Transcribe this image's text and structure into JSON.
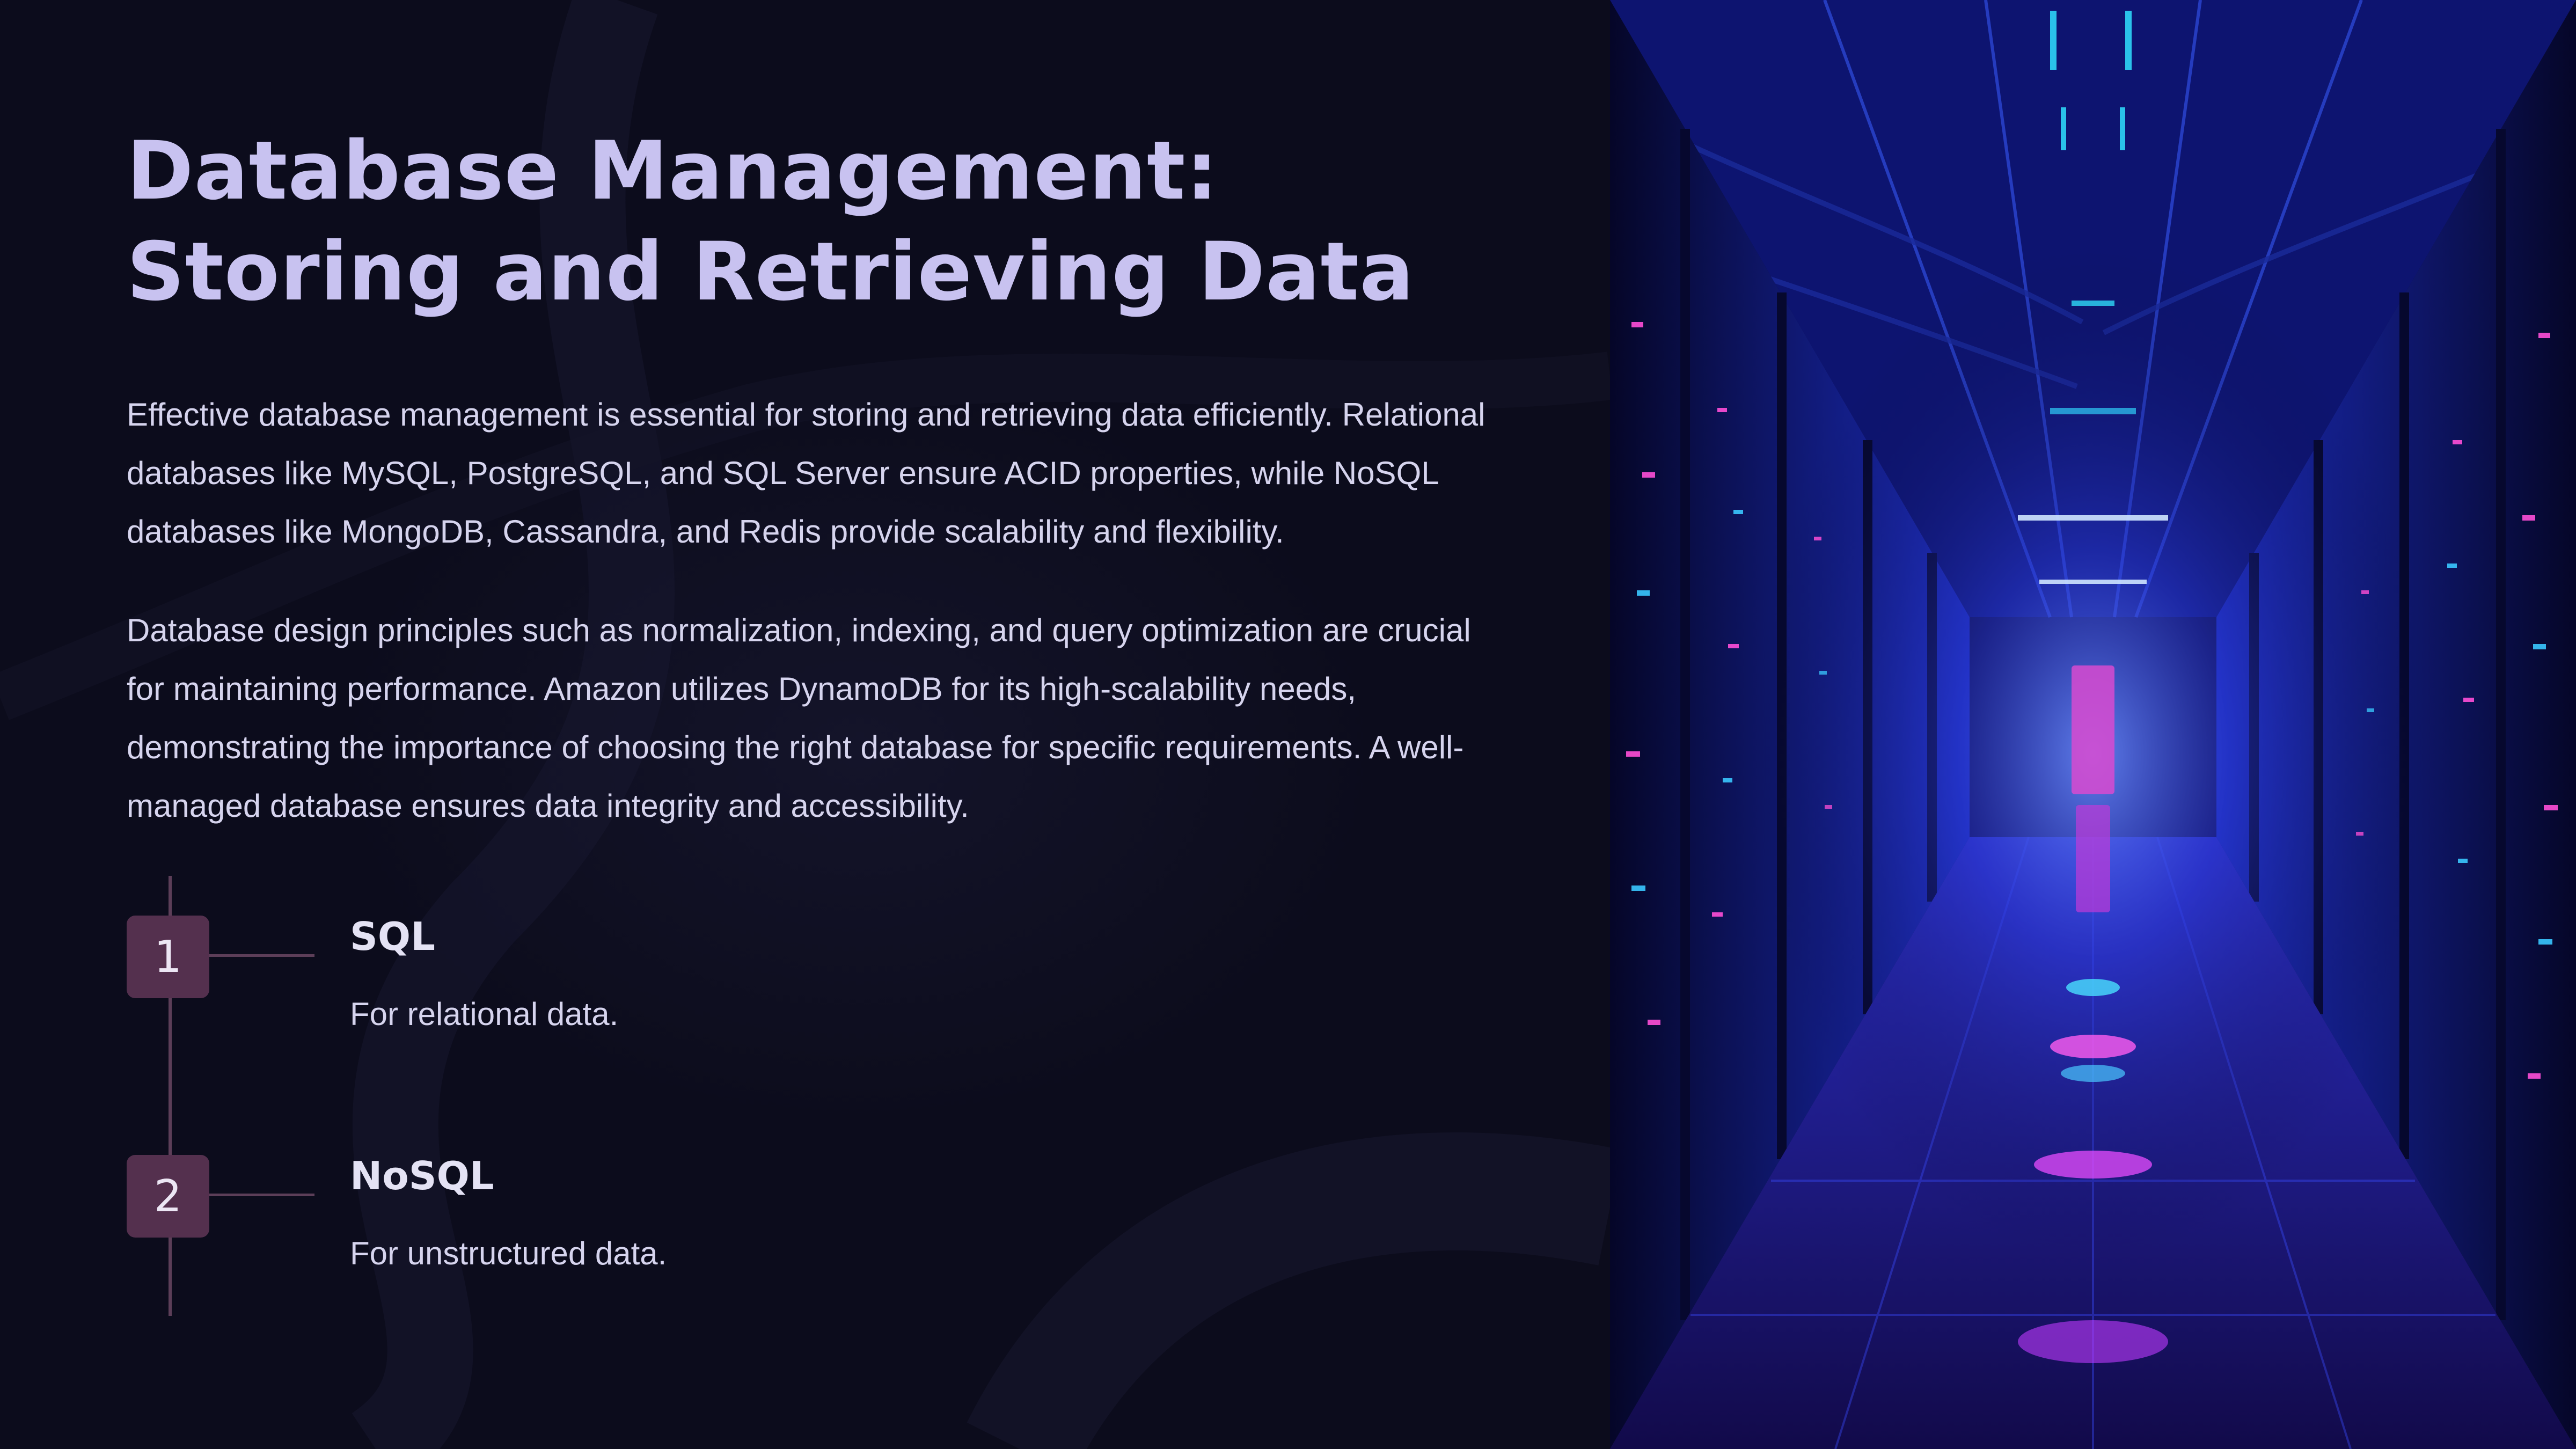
{
  "slide": {
    "title": "Database Management: Storing and Retrieving Data",
    "paragraphs": [
      "Effective database management is essential for storing and retrieving data efficiently. Relational databases like MySQL, PostgreSQL, and SQL Server ensure ACID properties, while NoSQL databases like MongoDB, Cassandra, and Redis provide scalability and flexibility.",
      "Database design principles such as normalization, indexing, and query optimization are crucial for maintaining performance. Amazon utilizes DynamoDB for its high-scalability needs, demonstrating the importance of choosing the right database for specific requirements. A well-managed database ensures data integrity and accessibility."
    ],
    "timeline": [
      {
        "number": "1",
        "title": "SQL",
        "description": "For relational data."
      },
      {
        "number": "2",
        "title": "NoSQL",
        "description": "For unstructured data."
      }
    ]
  },
  "colors": {
    "background": "#0c0c1c",
    "title": "#c8c2f0",
    "body_text": "#d6d4ee",
    "marker": "#54304e",
    "timeline_line": "#5c3e58",
    "image_accent_blue": "#2a40ff",
    "image_accent_magenta": "#ff3cd2"
  }
}
